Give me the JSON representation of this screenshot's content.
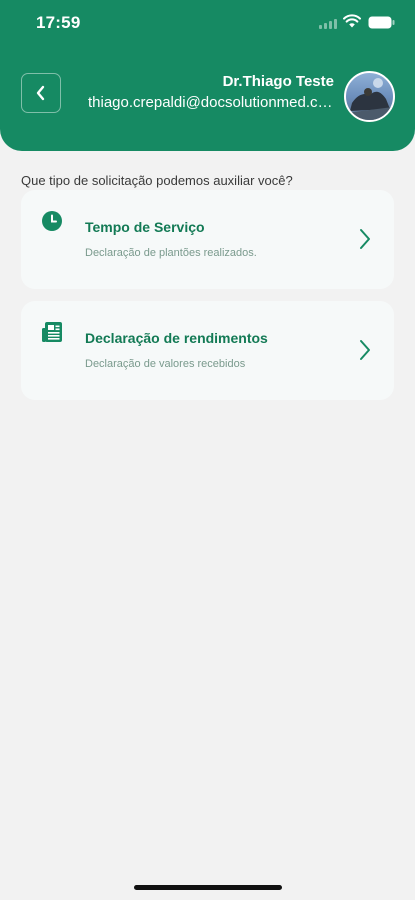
{
  "status_bar": {
    "time": "17:59"
  },
  "header": {
    "user_name": "Dr.Thiago Teste",
    "user_email": "thiago.crepaldi@docsolutionmed.com.br"
  },
  "prompt": "Que tipo de solicitação podemos auxiliar você?",
  "cards": [
    {
      "icon": "clock-icon",
      "title": "Tempo de Serviço",
      "subtitle": "Declaração de plantões realizados."
    },
    {
      "icon": "newspaper-icon",
      "title": "Declaração de rendimentos",
      "subtitle": "Declaração de valores recebidos"
    }
  ],
  "colors": {
    "primary": "#168a63",
    "card_background": "#f6f9f9",
    "page_background": "#f2f2f2",
    "title_text": "#137a55",
    "subtitle_text": "#7a9a8d"
  }
}
